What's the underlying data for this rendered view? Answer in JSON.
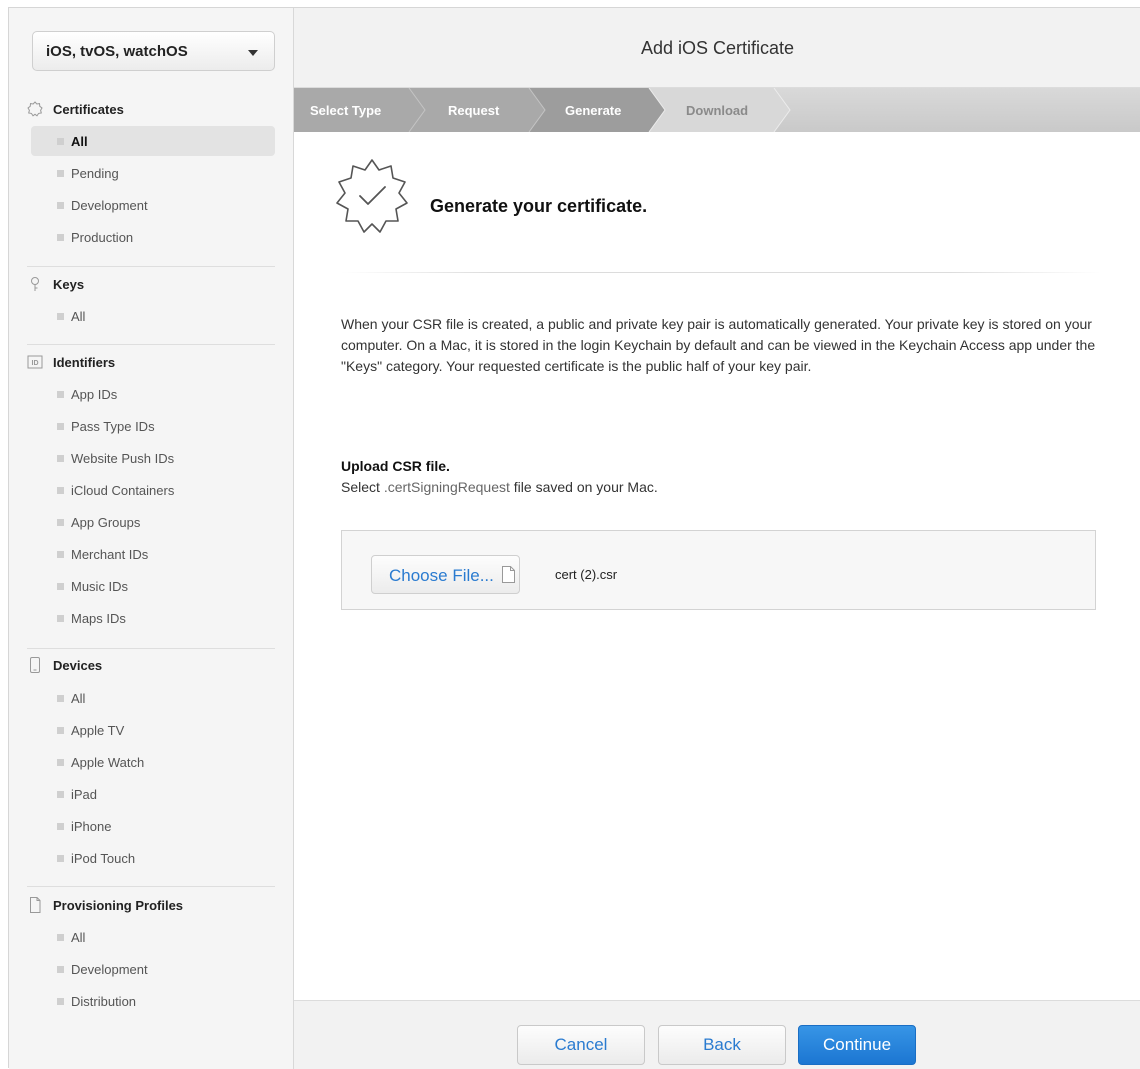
{
  "platform_select": {
    "value": "iOS, tvOS, watchOS"
  },
  "sidebar": {
    "certificates": {
      "label": "Certificates",
      "items": [
        "All",
        "Pending",
        "Development",
        "Production"
      ]
    },
    "keys": {
      "label": "Keys",
      "items": [
        "All"
      ]
    },
    "identifiers": {
      "label": "Identifiers",
      "items": [
        "App IDs",
        "Pass Type IDs",
        "Website Push IDs",
        "iCloud Containers",
        "App Groups",
        "Merchant IDs",
        "Music IDs",
        "Maps IDs"
      ]
    },
    "devices": {
      "label": "Devices",
      "items": [
        "All",
        "Apple TV",
        "Apple Watch",
        "iPad",
        "iPhone",
        "iPod Touch"
      ]
    },
    "profiles": {
      "label": "Provisioning Profiles",
      "items": [
        "All",
        "Development",
        "Distribution"
      ]
    },
    "active_item": "Certificates / All"
  },
  "header": {
    "title": "Add iOS Certificate"
  },
  "steps": [
    "Select Type",
    "Request",
    "Generate",
    "Download"
  ],
  "current_step": "Generate",
  "content": {
    "title": "Generate your certificate.",
    "description": "When your CSR file is created, a public and private key pair is automatically generated. Your private key is stored on your computer. On a Mac, it is stored in the login Keychain by default and can be viewed in the Keychain Access app under the \"Keys\" category. Your requested certificate is the public half of your key pair.",
    "upload_title": "Upload CSR file.",
    "upload_sub_prefix": "Select ",
    "upload_sub_ext": ".certSigningRequest",
    "upload_sub_suffix": " file saved on your Mac.",
    "choose_file_label": "Choose File...",
    "file_name": "cert (2).csr"
  },
  "footer": {
    "cancel": "Cancel",
    "back": "Back",
    "continue": "Continue"
  },
  "colors": {
    "accent": "#1c76d2",
    "link": "#2a7bd0",
    "step_active": "#9b9b9b",
    "step_done": "#a8a8a8",
    "step_pending": "#dadada"
  }
}
